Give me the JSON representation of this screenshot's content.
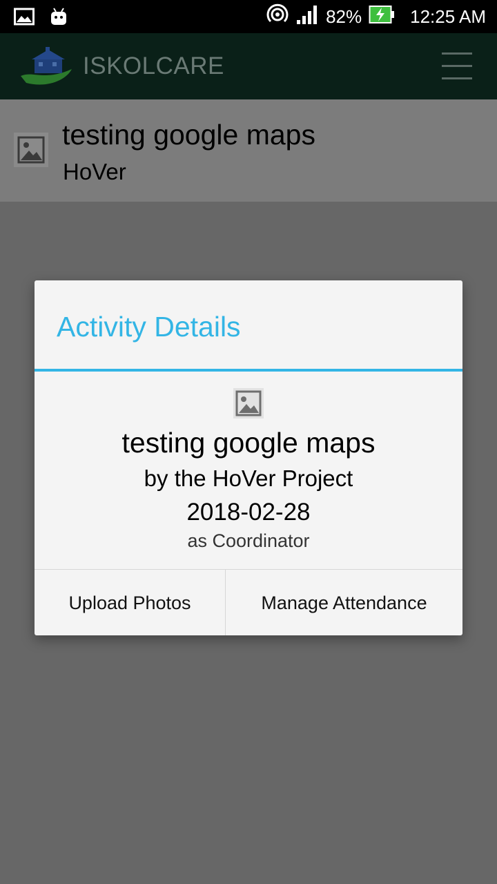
{
  "status_bar": {
    "battery": "82%",
    "time": "12:25 AM"
  },
  "app_bar": {
    "title": "ISKOLCARE",
    "menu_icon": "hamburger-menu-icon"
  },
  "list_item": {
    "title": "testing google maps",
    "subtitle": "HoVer",
    "icon": "image-placeholder-icon"
  },
  "dialog": {
    "title": "Activity Details",
    "accent_color": "#33b5e5",
    "icon": "image-placeholder-icon",
    "activity_title": "testing google maps",
    "byline": "by the HoVer Project",
    "date": "2018-02-28",
    "role": "as Coordinator",
    "buttons": {
      "upload": "Upload Photos",
      "manage": "Manage Attendance"
    }
  }
}
